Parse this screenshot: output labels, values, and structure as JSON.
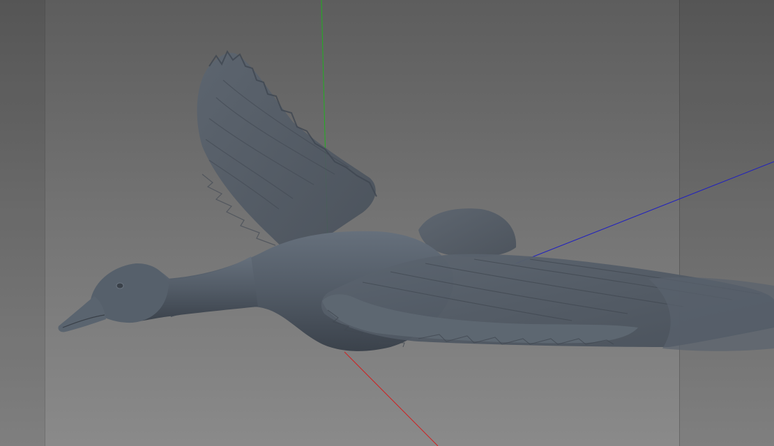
{
  "viewport": {
    "background_top": "#5d5d5d",
    "background_bottom": "#8a8a8a",
    "model_color": "#525b66",
    "model_shadow": "#3b424b",
    "model_highlight": "#6f7985"
  },
  "axes": {
    "x_color": "#d02020",
    "y_color": "#20b020",
    "z_color": "#2020c0"
  },
  "model": {
    "icon": "goose-3d-model"
  }
}
